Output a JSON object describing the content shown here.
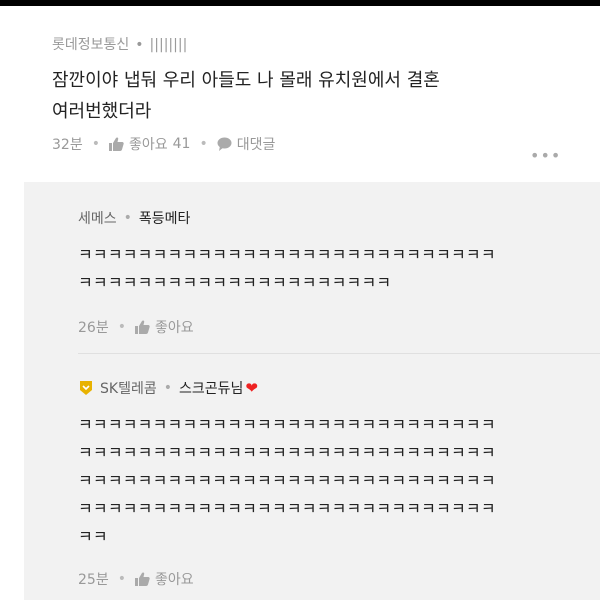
{
  "post": {
    "author": "롯데정보통신",
    "author_extra": "||||||||",
    "line1": "잠깐이야 냅둬 우리 아들도 나 몰래 유치원에서 결혼",
    "line2": "여러번했더라",
    "time": "32분",
    "like_label": "좋아요",
    "like_count": "41",
    "reply_label": "대댓글",
    "more": "•••"
  },
  "comments": [
    {
      "company": "세메스",
      "nickname": "폭등메타",
      "lines": [
        "ㅋㅋㅋㅋㅋㅋㅋㅋㅋㅋㅋㅋㅋㅋㅋㅋㅋㅋㅋㅋㅋㅋㅋㅋㅋㅋㅋㅋ",
        "ㅋㅋㅋㅋㅋㅋㅋㅋㅋㅋㅋㅋㅋㅋㅋㅋㅋㅋㅋㅋㅋ"
      ],
      "time": "26분",
      "like_label": "좋아요"
    },
    {
      "company": "SK텔레콤",
      "nickname": "스크곤듀님",
      "heart": "❤",
      "lines": [
        "ㅋㅋㅋㅋㅋㅋㅋㅋㅋㅋㅋㅋㅋㅋㅋㅋㅋㅋㅋㅋㅋㅋㅋㅋㅋㅋㅋㅋ",
        "ㅋㅋㅋㅋㅋㅋㅋㅋㅋㅋㅋㅋㅋㅋㅋㅋㅋㅋㅋㅋㅋㅋㅋㅋㅋㅋㅋㅋ",
        "ㅋㅋㅋㅋㅋㅋㅋㅋㅋㅋㅋㅋㅋㅋㅋㅋㅋㅋㅋㅋㅋㅋㅋㅋㅋㅋㅋㅋ",
        "ㅋㅋㅋㅋㅋㅋㅋㅋㅋㅋㅋㅋㅋㅋㅋㅋㅋㅋㅋㅋㅋㅋㅋㅋㅋㅋㅋㅋ",
        "ㅋㅋ"
      ],
      "time": "25분",
      "like_label": "좋아요"
    }
  ],
  "colors": {
    "heart": "#e22222",
    "badge": "#e8b200",
    "comment_bg": "#f2f2f2"
  }
}
